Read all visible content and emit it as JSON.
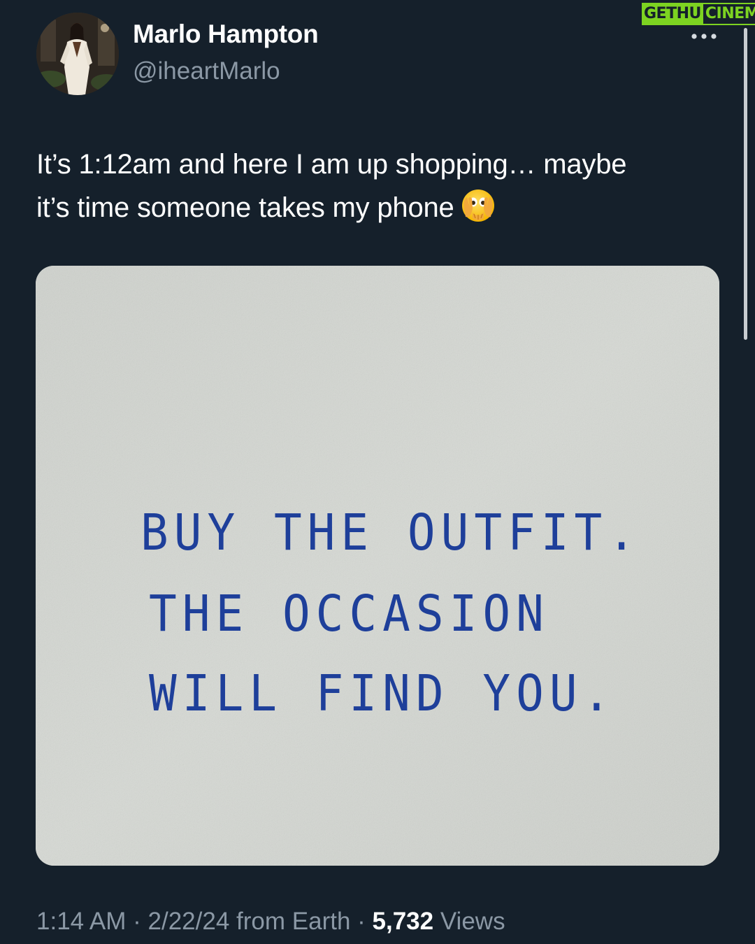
{
  "author": {
    "display_name": "Marlo Hampton",
    "handle": "@iheartMarlo",
    "avatar_icon": "profile-photo"
  },
  "more_icon": "more-horizontal-icon",
  "watermark": {
    "part1": "GETHU",
    "part2": "CINEMA",
    "color": "#7dd321"
  },
  "tweet": {
    "text_line1": "It’s 1:12am and here I am up shopping… maybe",
    "text_line2": "it’s time someone takes my phone",
    "emoji": "face-with-open-eyes-and-hand-over-mouth"
  },
  "media": {
    "line1": "BUY THE OUTFIT.",
    "line2": "THE OCCASION",
    "line3": "WILL FIND YOU.",
    "ink_color": "#1e3f9a",
    "paper_color": "#d4d7d2"
  },
  "meta": {
    "time": "1:14 AM",
    "sep1": " · ",
    "date": "2/22/24",
    "source": " from Earth",
    "sep2": " · ",
    "views_count": "5,732",
    "views_label": " Views"
  },
  "theme": {
    "background": "#15202b",
    "secondary_text": "#8b98a5",
    "primary_text": "#ffffff"
  }
}
